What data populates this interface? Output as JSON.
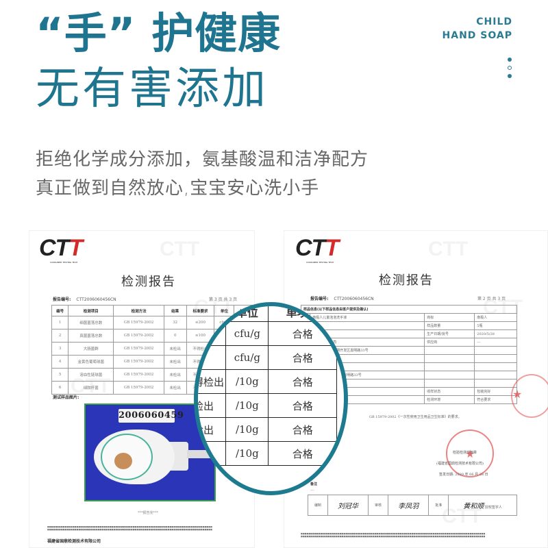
{
  "header": {
    "title_line1": "“手” 护健康",
    "title_line2": "无有害添加",
    "brand_line1": "CHILD",
    "brand_line2": "HAND SOAP",
    "pager_dots": [
      "filled",
      "hollow",
      "filled"
    ],
    "accent_color": "#1f7590"
  },
  "subtitle": {
    "line1": "拒绝化学成分添加，氨基酸温和洁净配方",
    "line2": "真正做到自然放心,宝宝安心洗小手"
  },
  "report_left": {
    "logo": "CTT",
    "logo_sub": "CONSUMER TESTING TECH",
    "title": "检测报告",
    "report_no_label": "报告编号:",
    "report_no": "CTT2006060456CN",
    "page_info": "第 3 页   共 3 页",
    "columns": [
      "编号",
      "检测项目",
      "检测方法",
      "结果",
      "标准要求",
      "单位",
      "单项判"
    ],
    "rows": [
      [
        "1",
        "细菌菌落总数",
        "GB 15979-2002",
        "32",
        "≤200",
        "cfu/g",
        ""
      ],
      [
        "2",
        "真菌菌落总数",
        "GB 15979-2002",
        "0",
        "≤100",
        "cfu/g",
        ""
      ],
      [
        "3",
        "大肠菌群",
        "GB 15979-2002",
        "未检出",
        "不得检出",
        "",
        ""
      ],
      [
        "4",
        "金黄色葡萄球菌",
        "GB 15979-2002",
        "未检出",
        "不得检出",
        "",
        ""
      ],
      [
        "5",
        "溶血性链球菌",
        "GB 15979-2002",
        "未检出",
        "不得检出",
        "",
        ""
      ],
      [
        "6",
        "绿脓杆菌",
        "GB 15979-2002",
        "未检出",
        "不得检出",
        "",
        ""
      ]
    ],
    "photo_label": "测试样品图片:",
    "sample_id": "2006060459",
    "report_end": "***报告完***",
    "company": "福建省国鼎检测技术有限公司"
  },
  "magnifier": {
    "columns": [
      "",
      "单位",
      "单项判"
    ],
    "rows": [
      [
        "",
        "cfu/g",
        "合格"
      ],
      [
        "0",
        "cfu/g",
        "合格"
      ],
      [
        "得检出",
        "/10g",
        "合格"
      ],
      [
        "检出",
        "/10g",
        "合格"
      ],
      [
        "检出",
        "/10g",
        "合格"
      ],
      [
        "",
        "/10g",
        "合格"
      ]
    ]
  },
  "report_right": {
    "logo": "CTT",
    "logo_sub": "CONSUMER TESTING TECH",
    "title": "检测报告",
    "report_no_label": "报告编号:",
    "report_no": "CTT2006060456CN",
    "page_info": "第 2 页   共 3 页",
    "info_header": "样品信息(以下样品信息由客户提供及确认)",
    "info_rows": [
      [
        "",
        "南极人儿童泡泡洗手液",
        "商标",
        "南极人"
      ],
      [
        "",
        "---",
        "样品数量",
        "5瓶"
      ],
      [
        "",
        "瓶/瓶",
        "生产日期/批号",
        "2020/5/28"
      ],
      [
        "",
        "妍日化有限公司",
        "供应商",
        "---"
      ],
      [
        "",
        "城市东昌府区嘉明开发区嘉明路33号",
        "",
        ""
      ],
      [
        "",
        "",
        "",
        ""
      ],
      [
        "",
        "化有限公司",
        "",
        ""
      ],
      [
        "",
        "东昌府区嘉明开发区嘉明路33号",
        "",
        ""
      ],
      [
        "",
        "",
        "",
        ""
      ],
      [
        "",
        "17 日",
        "收样状态",
        "包装完好"
      ],
      [
        "",
        "28 日",
        "检测环境",
        "符合要求"
      ]
    ],
    "conclusion": "GB 15979-2002《一次性使用卫生用品卫生标准》的要求。",
    "stamp_line1": "检验检测专用章",
    "stamp_line2": "(福建省国鼎检测技术有限公司)",
    "sign_date": "签发日期: 2020 年 06 月 28 日",
    "remark_label": "备注",
    "remark_value": "---",
    "sign_labels": [
      "编制",
      "审核",
      "批准"
    ],
    "signatures": [
      "刘冠华",
      "李凤羽",
      "黄和顺"
    ],
    "signatory": "授权签字人"
  }
}
